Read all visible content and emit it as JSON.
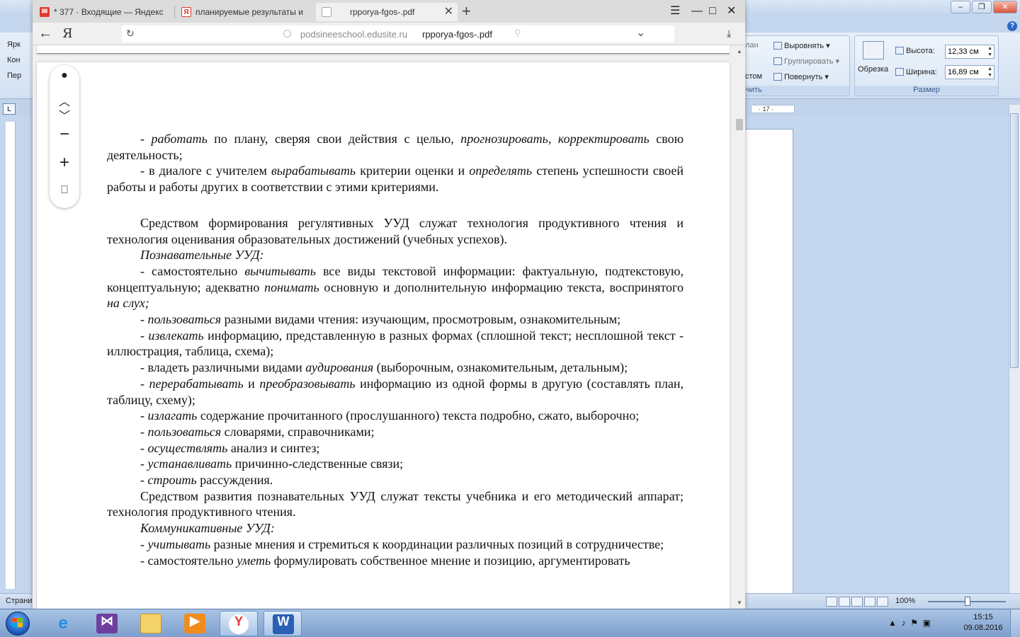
{
  "word": {
    "ribbon": {
      "left_items": [
        "Ярк",
        "Кон",
        "Пер"
      ],
      "arrange_items": [
        "лан",
        "Выровнять",
        "Группировать",
        "стом",
        "Повернуть"
      ],
      "arrange_label": "чить",
      "crop_label": "Обрезка",
      "height_label": "Высота:",
      "height_value": "12,33 см",
      "width_label": "Ширина:",
      "width_value": "16,89 см",
      "size_group_label": "Размер"
    },
    "ruler_marker": "· 17 ·",
    "status": {
      "page_label": "Страни",
      "zoom": "100%"
    }
  },
  "browser": {
    "tabs": [
      {
        "label": "* 377 · Входящие — Яндекс",
        "favicon": "mail-icon",
        "color": "#e03a2f"
      },
      {
        "label": "планируемые результаты и",
        "favicon": "yandex-icon",
        "color": "#e03a2f"
      },
      {
        "label": "rpporya-fgos-.pdf",
        "favicon": "pdf-icon",
        "color": "#bbbbbb",
        "active": true
      }
    ],
    "nav": {
      "yandex_logo": "Я",
      "domain": "podsineeschool.edusite.ru",
      "path": "rpporya-fgos-.pdf"
    }
  },
  "document": {
    "paragraphs": [
      [
        {
          "t": "- "
        },
        {
          "t": "работать",
          "i": true
        },
        {
          "t": " по плану, сверяя свои действия с целью, "
        },
        {
          "t": "прогнозировать, корректировать",
          "i": true
        },
        {
          "t": " свою деятельность;"
        }
      ],
      [
        {
          "t": "-   в диалоге с учителем "
        },
        {
          "t": "вырабатывать",
          "i": true
        },
        {
          "t": " критерии оценки и "
        },
        {
          "t": "определять",
          "i": true
        },
        {
          "t": " степень успешности своей работы и работы других в соответствии с этими критериями."
        }
      ],
      [
        {
          "gap": true
        },
        {
          "t": "Средством формирования регулятивных УУД служат технология продуктивного чтения и технология оценивания образовательных достижений (учебных успехов)."
        }
      ],
      [
        {
          "t": "Познавательные УУД:",
          "i": true
        }
      ],
      [
        {
          "t": "-   самостоятельно "
        },
        {
          "t": "вычитывать",
          "i": true
        },
        {
          "t": " все виды текстовой информации: фактуальную, подтекстовую, концептуальную; адекватно "
        },
        {
          "t": "понимать",
          "i": true
        },
        {
          "t": " основную и дополнительную информацию текста, воспринятого "
        },
        {
          "t": "на слух;",
          "i": true
        }
      ],
      [
        {
          "t": "-   "
        },
        {
          "t": "пользоваться",
          "i": true
        },
        {
          "t": " разными видами чтения: изучающим, просмотровым, ознакомительным;"
        }
      ],
      [
        {
          "t": "-   "
        },
        {
          "t": "извлекать",
          "i": true
        },
        {
          "t": " информацию, представленную в разных формах (сплошной текст; несплошной текст - иллюстрация, таблица, схема);"
        }
      ],
      [
        {
          "t": "- владеть различными видами "
        },
        {
          "t": "аудирования",
          "i": true
        },
        {
          "t": " (выборочным, ознакомительным, детальным);"
        }
      ],
      [
        {
          "t": "- "
        },
        {
          "t": "перерабатывать",
          "i": true
        },
        {
          "t": " и "
        },
        {
          "t": "преобразовывать",
          "i": true
        },
        {
          "t": " информацию из одной формы в другую (составлять план, таблицу, схему);"
        }
      ],
      [
        {
          "t": "-   "
        },
        {
          "t": "излагать",
          "i": true
        },
        {
          "t": " содержание прочитанного (прослушанного) текста подробно, сжато, выборочно;"
        }
      ],
      [
        {
          "t": "- "
        },
        {
          "t": "пользоваться",
          "i": true
        },
        {
          "t": " словарями, справочниками;"
        }
      ],
      [
        {
          "t": "- "
        },
        {
          "t": "осуществлять",
          "i": true
        },
        {
          "t": " анализ и синтез;"
        }
      ],
      [
        {
          "t": "- "
        },
        {
          "t": "устанавливать",
          "i": true
        },
        {
          "t": " причинно-следственные связи;"
        }
      ],
      [
        {
          "t": "- "
        },
        {
          "t": "строить",
          "i": true
        },
        {
          "t": " рассуждения."
        }
      ],
      [
        {
          "t": "Средством развития познавательных УУД служат тексты учебника и его методический аппарат; технология продуктивного чтения."
        }
      ],
      [
        {
          "t": "Коммуникативные УУД:",
          "i": true
        }
      ],
      [
        {
          "t": "-   "
        },
        {
          "t": "учитывать",
          "i": true
        },
        {
          "t": " разные мнения и стремиться к координации различных позиций в сотрудничестве;"
        }
      ],
      [
        {
          "t": "-   самостоятельно "
        },
        {
          "t": "уметь",
          "i": true
        },
        {
          "t": " формулировать собственное мнение и позицию, аргументировать"
        }
      ]
    ]
  },
  "taskbar": {
    "apps": [
      "ie-icon",
      "visual-studio-icon",
      "explorer-icon",
      "media-player-icon",
      "yandex-browser-icon",
      "word-icon"
    ],
    "time": "15:15",
    "date": "09.08.2016"
  }
}
